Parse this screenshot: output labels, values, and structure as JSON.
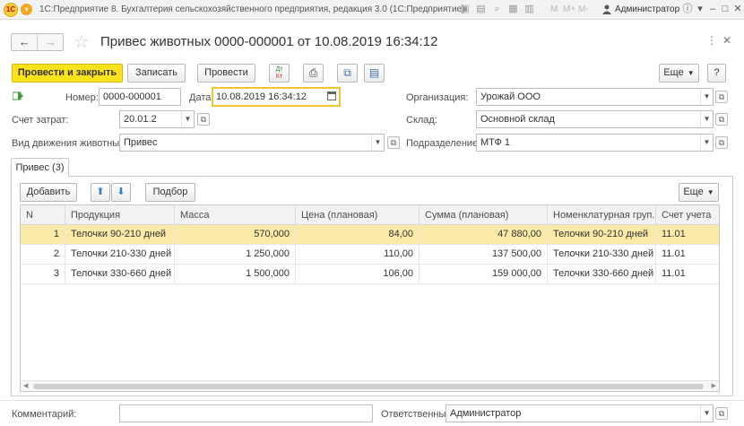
{
  "app": {
    "title": "1С:Предприятие 8. Бухгалтерия сельскохозяйственного предприятия, редакция 3.0  (1С:Предприятие)",
    "user": "Администратор",
    "m_buttons": [
      "M",
      "M+",
      "M-"
    ]
  },
  "form": {
    "title": "Привес животных 0000-000001 от 10.08.2019 16:34:12"
  },
  "toolbar": {
    "post_close": "Провести и закрыть",
    "save": "Записать",
    "post": "Провести",
    "dtkt_top": "Дт",
    "dtkt_bottom": "Кт",
    "more": "Еще",
    "help": "?"
  },
  "fields": {
    "number_label": "Номер:",
    "number_value": "0000-000001",
    "date_label": "Дата:",
    "date_value": "10.08.2019 16:34:12",
    "org_label": "Организация:",
    "org_value": "Урожай ООО",
    "cost_account_label": "Счет затрат:",
    "cost_account_value": "20.01.2",
    "warehouse_label": "Склад:",
    "warehouse_value": "Основной склад",
    "movement_label": "Вид движения животных:",
    "movement_value": "Привес",
    "division_label": "Подразделение:",
    "division_value": "МТФ 1",
    "comment_label": "Комментарий:",
    "comment_value": "",
    "responsible_label": "Ответственный:",
    "responsible_value": "Администратор"
  },
  "tabs": [
    {
      "label": "Привес (3)"
    }
  ],
  "table_toolbar": {
    "add": "Добавить",
    "select": "Подбор",
    "more": "Еще"
  },
  "table": {
    "columns": [
      "N",
      "Продукция",
      "Масса",
      "Цена (плановая)",
      "Сумма (плановая)",
      "Номенклатурная груп...",
      "Счет учета"
    ],
    "rows": [
      [
        "1",
        "Телочки 90-210 дней",
        "570,000",
        "84,00",
        "47 880,00",
        "Телочки 90-210 дней",
        "11.01"
      ],
      [
        "2",
        "Телочки 210-330 дней",
        "1 250,000",
        "110,00",
        "137 500,00",
        "Телочки 210-330 дней",
        "11.01"
      ],
      [
        "3",
        "Телочки 330-660 дней",
        "1 500,000",
        "106,00",
        "159 000,00",
        "Телочки 330-660 дней",
        "11.01"
      ]
    ]
  },
  "colors": {
    "accent": "#fde21c",
    "selected_row": "#fbeaa7",
    "focus_border": "#f4c430"
  }
}
